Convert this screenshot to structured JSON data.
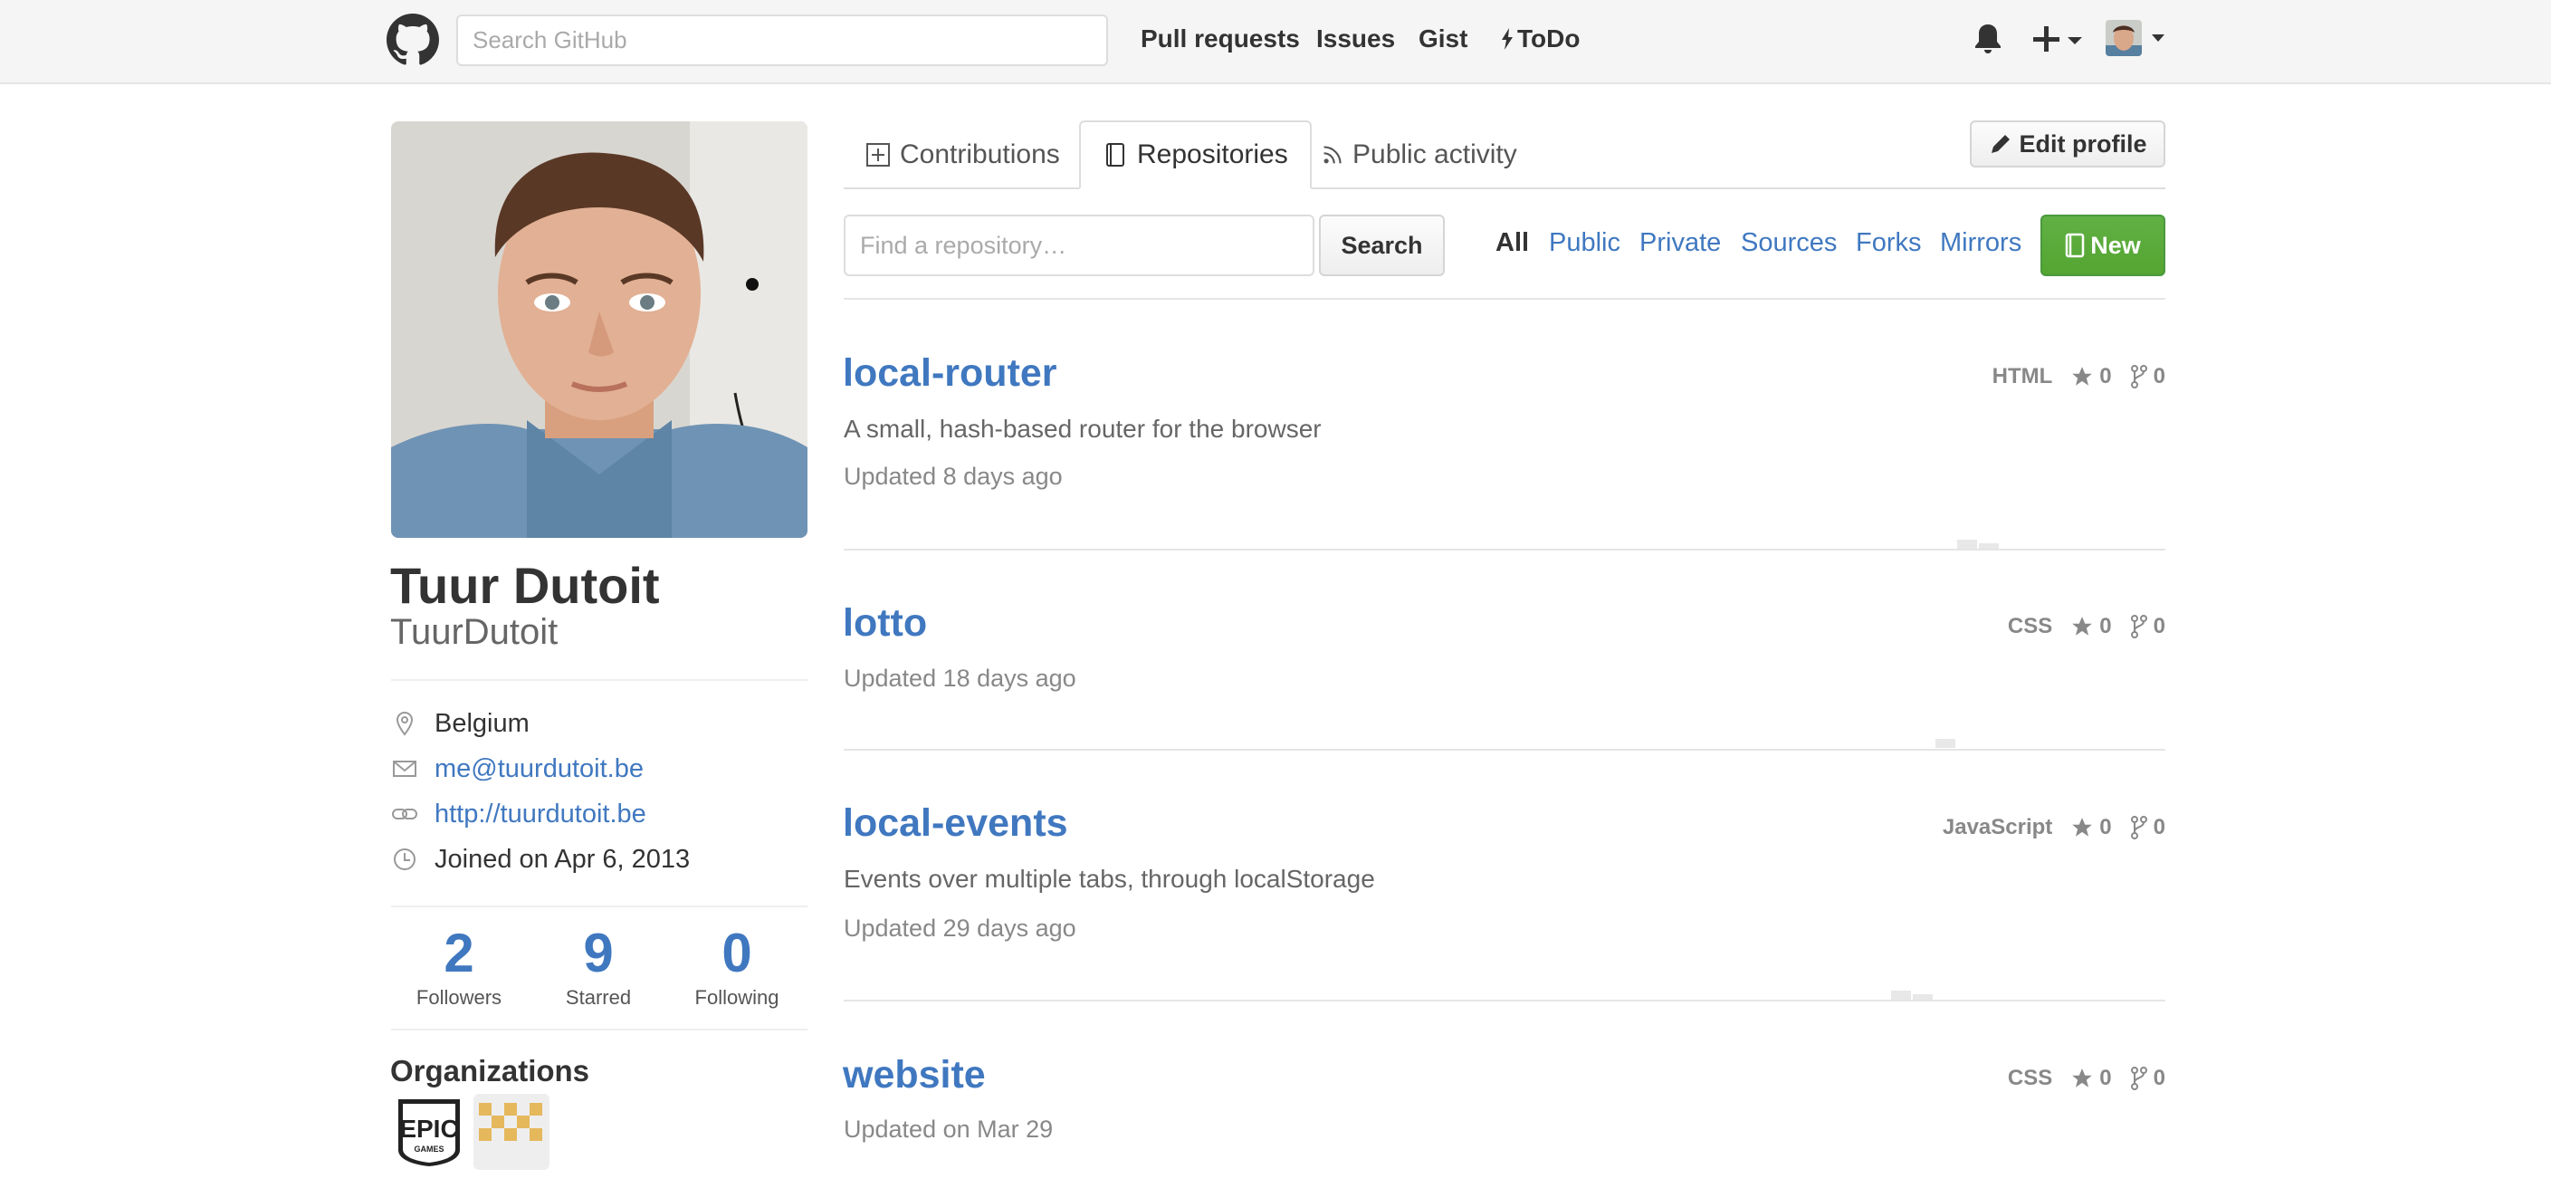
{
  "header": {
    "search_placeholder": "Search GitHub",
    "nav": [
      "Pull requests",
      "Issues",
      "Gist",
      "ToDo"
    ]
  },
  "profile": {
    "fullname": "Tuur Dutoit",
    "username": "TuurDutoit",
    "location": "Belgium",
    "email": "me@tuurdutoit.be",
    "website": "http://tuurdutoit.be",
    "joined": "Joined on Apr 6, 2013",
    "stats": [
      {
        "num": "2",
        "label": "Followers"
      },
      {
        "num": "9",
        "label": "Starred"
      },
      {
        "num": "0",
        "label": "Following"
      }
    ],
    "organizations_title": "Organizations",
    "organizations": [
      "EPIC GAMES",
      "yellow-pattern-org"
    ]
  },
  "tabs": [
    "Contributions",
    "Repositories",
    "Public activity"
  ],
  "edit_profile": "Edit profile",
  "filter": {
    "placeholder": "Find a repository…",
    "search_button": "Search",
    "types": [
      "All",
      "Public",
      "Private",
      "Sources",
      "Forks",
      "Mirrors"
    ],
    "new_button": "New"
  },
  "repos": [
    {
      "name": "local-router",
      "description": "A small, hash-based router for the browser",
      "updated": "Updated 8 days ago",
      "language": "HTML",
      "stars": "0",
      "forks": "0"
    },
    {
      "name": "lotto",
      "description": "",
      "updated": "Updated 18 days ago",
      "language": "CSS",
      "stars": "0",
      "forks": "0"
    },
    {
      "name": "local-events",
      "description": "Events over multiple tabs, through localStorage",
      "updated": "Updated 29 days ago",
      "language": "JavaScript",
      "stars": "0",
      "forks": "0"
    },
    {
      "name": "website",
      "description": "",
      "updated": "Updated on Mar 29",
      "language": "CSS",
      "stars": "0",
      "forks": "0"
    }
  ],
  "colors": {
    "link": "#4078c0",
    "new_button": "#60b044"
  }
}
